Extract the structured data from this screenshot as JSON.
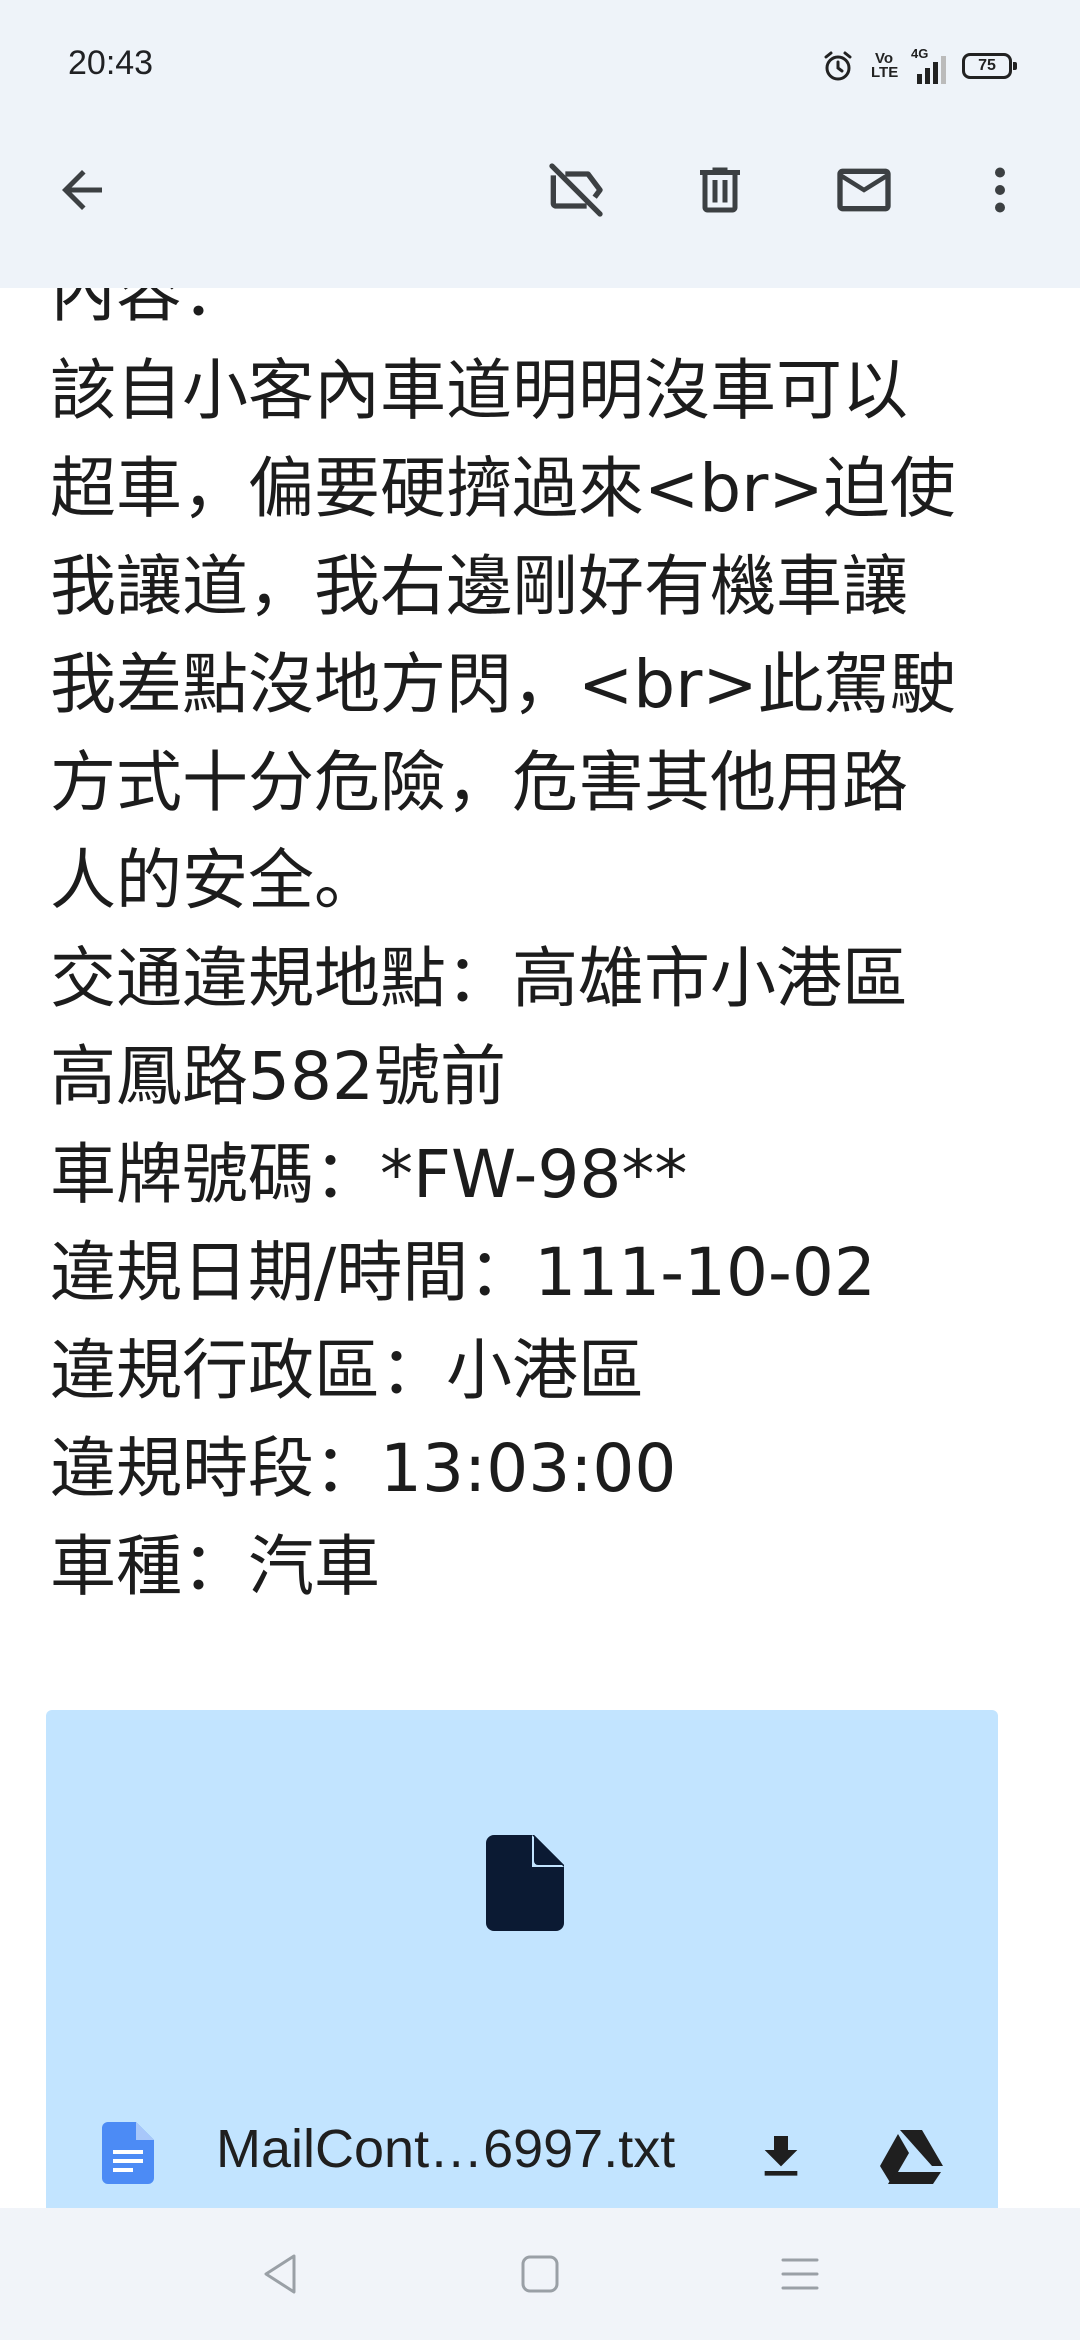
{
  "status_bar": {
    "time": "20:43",
    "network": "4G",
    "volte": "Vo LTE",
    "battery": "75",
    "icons": [
      "alarm-icon",
      "volte-icon",
      "signal-icon",
      "battery-icon"
    ]
  },
  "toolbar": {
    "icons": [
      "back-arrow-icon",
      "label-off-icon",
      "delete-icon",
      "mail-icon",
      "more-vert-icon"
    ]
  },
  "message": {
    "lines": [
      "內容：",
      "該自小客內車道明明沒車可以",
      "超車，偏要硬擠過來<br>迫使",
      "我讓道，我右邊剛好有機車讓",
      "我差點沒地方閃，<br>此駕駛",
      "方式十分危險，危害其他用路",
      "人的安全。",
      "交通違規地點：高雄市小港區",
      "高鳳路582號前",
      "車牌號碼：*FW-98**",
      "違規日期/時間：111-10-02",
      "違規行政區：小港區",
      "違規時段：13:03:00",
      "車種：汽車"
    ]
  },
  "attachment": {
    "file_name": "MailCont…6997.txt",
    "colors": {
      "card_bg": "#c2e4ff",
      "doc_icon": "#4c8bf5",
      "preview_icon": "#0b1a33"
    }
  },
  "colors": {
    "top_bg": "#eef3f9",
    "text": "#1c1c1c",
    "nav_bg": "#f1f4f9"
  }
}
